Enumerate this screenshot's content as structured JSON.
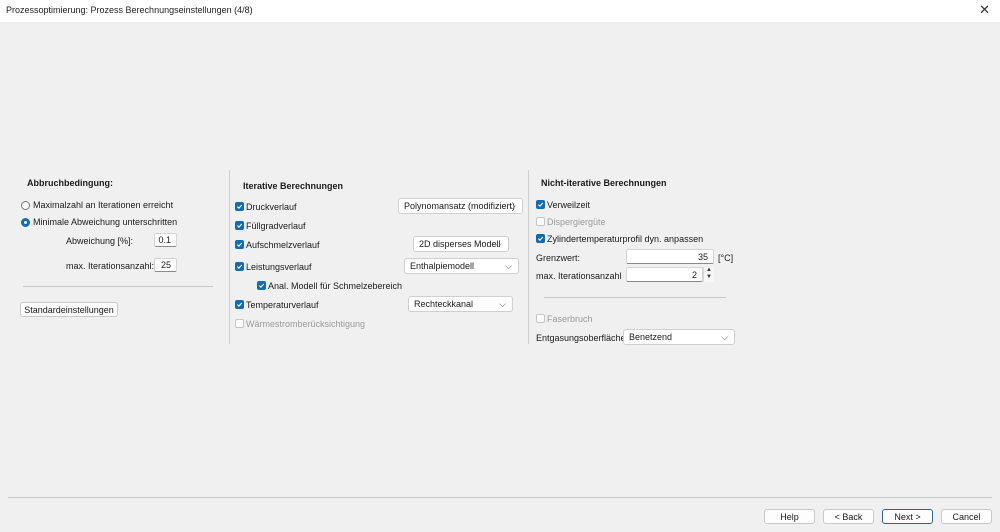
{
  "window": {
    "title": "Prozessoptimierung: Prozess Berechnungseinstellungen (4/8)",
    "close_glyph": "✕"
  },
  "abbruch": {
    "header": "Abbruchbedingung:",
    "radio_max": "Maximalzahl an Iterationen erreicht",
    "radio_min": "Minimale Abweichung unterschritten",
    "abweichung_label": "Abweichung [%]:",
    "abweichung_value": "0.1",
    "iterations_label": "max. Iterationsanzahl:",
    "iterations_value": "25",
    "selected": "Minimale Abweichung unterschritten",
    "defaults_button": "Standardeinstellungen"
  },
  "iterative": {
    "header": "Iterative Berechnungen",
    "druck": {
      "label": "Druckverlauf",
      "checked": true,
      "select": "Polynomansatz (modifiziert)"
    },
    "fuellgrad": {
      "label": "Füllgradverlauf",
      "checked": true
    },
    "aufschmelz": {
      "label": "Aufschmelzverlauf",
      "checked": true,
      "select": "2D disperses Modell"
    },
    "leistung": {
      "label": "Leistungsverlauf",
      "checked": true,
      "select": "Enthalpiemodell"
    },
    "anal": {
      "label": "Anal. Modell für Schmelzebereich",
      "checked": true
    },
    "temperatur": {
      "label": "Temperaturverlauf",
      "checked": true,
      "select": "Rechteckkanal"
    },
    "waerme": {
      "label": "Wärmestromberücksichtigung",
      "checked": false,
      "disabled": true
    }
  },
  "noniterative": {
    "header": "Nicht-iterative Berechnungen",
    "verweilzeit": {
      "label": "Verweilzeit",
      "checked": true
    },
    "dispergier": {
      "label": "Dispergiergüte",
      "checked": false,
      "disabled": true
    },
    "zylinder": {
      "label": "Zylindertemperaturprofil dyn. anpassen",
      "checked": true
    },
    "grenzwert_label": "Grenzwert:",
    "grenzwert_value": "35",
    "grenzwert_unit": "[°C]",
    "max_iter_label": "max. Iterationsanzahl",
    "max_iter_value": "2",
    "faserbruch": {
      "label": "Faserbruch",
      "checked": false,
      "disabled": true
    },
    "entgasung_label": "Entgasungsoberfläche:",
    "entgasung_select": "Benetzend"
  },
  "footer": {
    "help": "Help",
    "back": "< Back",
    "next": "Next >",
    "cancel": "Cancel"
  },
  "colors": {
    "accent": "#0f6cbd",
    "background": "#f0f0f0",
    "disabled_text": "#9a9a9a"
  },
  "icons": {
    "check": "checkmark-icon",
    "chevron": "chevron-down-icon",
    "spin_up": "spin-up-icon",
    "spin_down": "spin-down-icon"
  }
}
